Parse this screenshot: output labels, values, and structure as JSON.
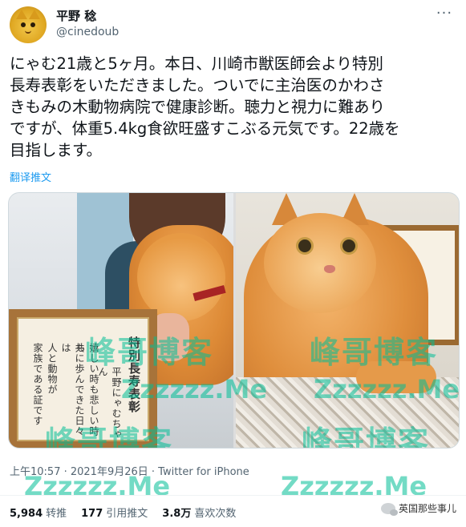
{
  "tweet": {
    "display_name": "平野 稔",
    "handle": "@cinedoub",
    "more_label": "···",
    "text": "にゃむ21歳と5ヶ月。本日、川崎市獣医師会より特別\n長寿表彰をいただきました。ついでに主治医のかわさ\nきもみの木動物病院で健康診断。聴力と視力に難あり\nですが、体重5.4kg食欲旺盛すこぶる元気です。22歳を\n目指します。",
    "translate_label": "翻译推文",
    "certificate_left": {
      "title": "特別長寿表彰",
      "name": "平野にゃむちゃん",
      "line1": "嬉しい時も悲しい時も",
      "line2": "共に歩んできた日々は",
      "line3": "人と動物が",
      "line4": "家族である証です"
    },
    "timestamp": "上午10:57 · 2021年9月26日",
    "source": "Twitter for iPhone",
    "stats": {
      "retweets_count": "5,984",
      "retweets_label": "转推",
      "quotes_count": "177",
      "quotes_label": "引用推文",
      "likes_count": "3.8万",
      "likes_label": "喜欢次数"
    }
  },
  "watermarks": {
    "cn": "峰哥博客",
    "en": "Zzzzzz.Me",
    "wechat": "英国那些事儿"
  },
  "colors": {
    "link": "#1d9bf0",
    "secondary_text": "#536471",
    "primary_text": "#0f1419",
    "watermark_green": "#00be96",
    "watermark_pink": "#f05a78"
  }
}
